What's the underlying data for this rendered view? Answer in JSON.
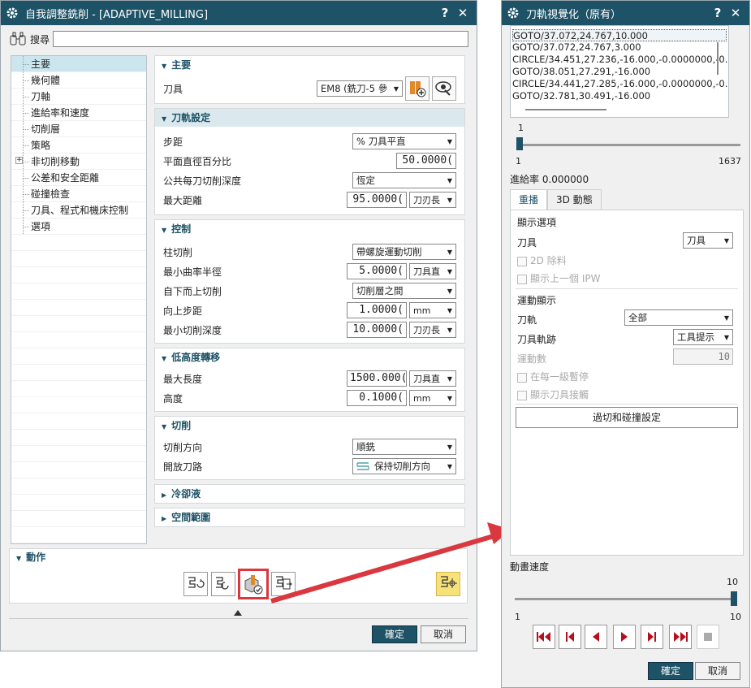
{
  "left_window": {
    "title": "自我調整銑削 - [ADAPTIVE_MILLING]",
    "help": "?",
    "close": "✕",
    "search_label": "搜尋",
    "search_value": "",
    "tree": [
      {
        "label": "主要",
        "selected": true
      },
      {
        "label": "幾何體"
      },
      {
        "label": "刀軸"
      },
      {
        "label": "進給率和速度"
      },
      {
        "label": "切削層"
      },
      {
        "label": "策略"
      },
      {
        "label": "非切削移動",
        "expandable": true
      },
      {
        "label": "公差和安全距離"
      },
      {
        "label": "碰撞檢查"
      },
      {
        "label": "刀具、程式和機床控制"
      },
      {
        "label": "選項"
      }
    ],
    "sections": {
      "main": {
        "title": "主要",
        "tool_label": "刀具",
        "tool_value": "EM8 (銑刀-5 參"
      },
      "path": {
        "title": "刀軌設定",
        "stepover_label": "步距",
        "stepover_value": "% 刀具平直",
        "percent_label": "平面直徑百分比",
        "percent_value": "50.0000(",
        "depth_label": "公共每刀切削深度",
        "depth_value": "恆定",
        "maxdist_label": "最大距離",
        "maxdist_value": "95.0000(",
        "maxdist_unit": "刀刃長"
      },
      "control": {
        "title": "控制",
        "wall_label": "柱切削",
        "wall_value": "帶螺旋運動切削",
        "radius_label": "最小曲率半徑",
        "radius_value": "5.0000(",
        "radius_unit": "刀具直",
        "bottomup_label": "自下而上切削",
        "bottomup_value": "切削層之間",
        "upstep_label": "向上步距",
        "upstep_value": "1.0000(",
        "upstep_unit": "mm",
        "mindepth_label": "最小切削深度",
        "mindepth_value": "10.0000(",
        "mindepth_unit": "刀刃長"
      },
      "lowtraverse": {
        "title": "低高度轉移",
        "maxlen_label": "最大長度",
        "maxlen_value": "1500.000(",
        "maxlen_unit": "刀具直",
        "height_label": "高度",
        "height_value": "0.1000(",
        "height_unit": "mm"
      },
      "cut": {
        "title": "切削",
        "dir_label": "切削方向",
        "dir_value": "順銑",
        "open_label": "開放刀路",
        "open_value": "保持切削方向"
      },
      "coolant": {
        "title": "冷卻液"
      },
      "space": {
        "title": "空間範圍"
      }
    },
    "actions_title": "動作",
    "ok": "確定",
    "cancel": "取消"
  },
  "right_window": {
    "title": "刀軌視覺化（原有）",
    "help": "?",
    "close": "✕",
    "gotos": [
      "GOTO/37.072,24.767,10.000",
      "GOTO/37.072,24.767,3.000",
      "CIRCLE/34.451,27.236,-16.000,-0.0000000,-0.0(",
      "GOTO/38.051,27.291,-16.000",
      "CIRCLE/34.441,27.285,-16.000,-0.0000000,-0.0(",
      "GOTO/32.781,30.491,-16.000"
    ],
    "slider_value": "1",
    "slider_min": "1",
    "slider_max": "1637",
    "feed_label": "進給率 0.000000",
    "tab_replay": "重播",
    "tab_3d": "3D 動態",
    "display_options": "顯示選項",
    "tool_label": "刀具",
    "tool_value": "刀具",
    "remove_2d": "2D 除料",
    "show_prev_ipw": "顯示上一個 IPW",
    "motion_display": "運動顯示",
    "path_label": "刀軌",
    "path_value": "全部",
    "trace_label": "刀具軌跡",
    "trace_value": "工具提示",
    "motions_label": "運動數",
    "motions_value": "10",
    "pause_each": "在每一級暫停",
    "show_holder": "顯示刀具接觸",
    "gouge_button": "過切和碰撞設定",
    "speed_label": "動畫速度",
    "speed_value": "10",
    "speed_min": "1",
    "speed_max": "10",
    "ok": "確定",
    "cancel": "取消"
  },
  "colors": {
    "title_bar": "#1e5266",
    "accent_red": "#d9383f",
    "nav_red": "#b40f1e"
  }
}
